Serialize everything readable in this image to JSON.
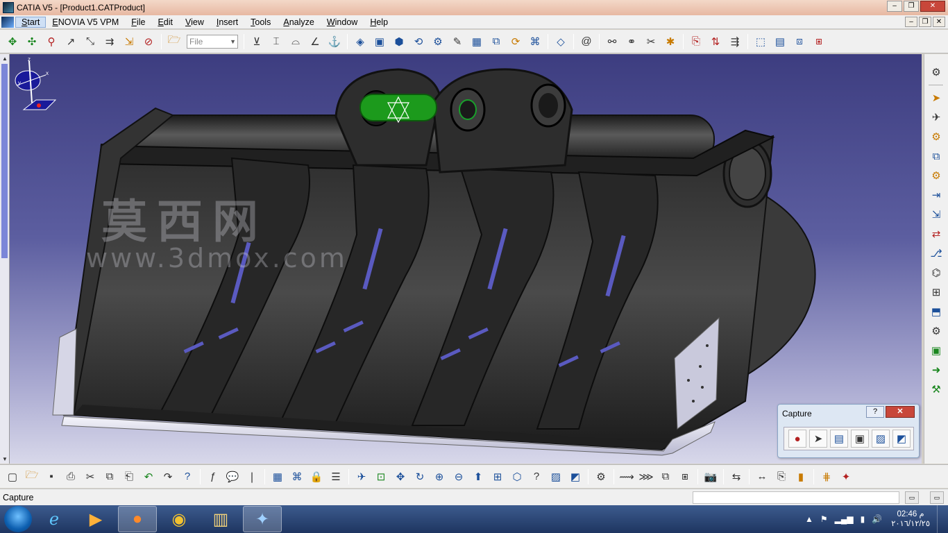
{
  "window": {
    "title": "CATIA V5 - [Product1.CATProduct]",
    "minimize": "–",
    "restore": "❐",
    "close": "✕"
  },
  "menu": {
    "items": [
      "Start",
      "ENOVIA V5 VPM",
      "File",
      "Edit",
      "View",
      "Insert",
      "Tools",
      "Analyze",
      "Window",
      "Help"
    ]
  },
  "top_toolbar": {
    "file_combo": "File",
    "icons": [
      "pan-arrows-icon",
      "rotate-arrows-icon",
      "snap-icon",
      "manipulate-icon",
      "explode-icon",
      "align-icon",
      "clash-icon",
      "open-folder-icon"
    ]
  },
  "watermark": {
    "chinese": "莫西网",
    "url": "www.3dmox.com"
  },
  "capture_panel": {
    "title": "Capture",
    "help": "?",
    "close": "✕"
  },
  "status": {
    "text": "Capture"
  },
  "taskbar": {
    "clock_time": "02:46 م",
    "clock_date": "٢٠١٦/١٢/٢٥"
  },
  "colors": {
    "viewport_top": "#3d3d80",
    "viewport_bottom": "#d8d8ea",
    "accent_green": "#19861e",
    "accent_blue": "#1b4f9a"
  }
}
